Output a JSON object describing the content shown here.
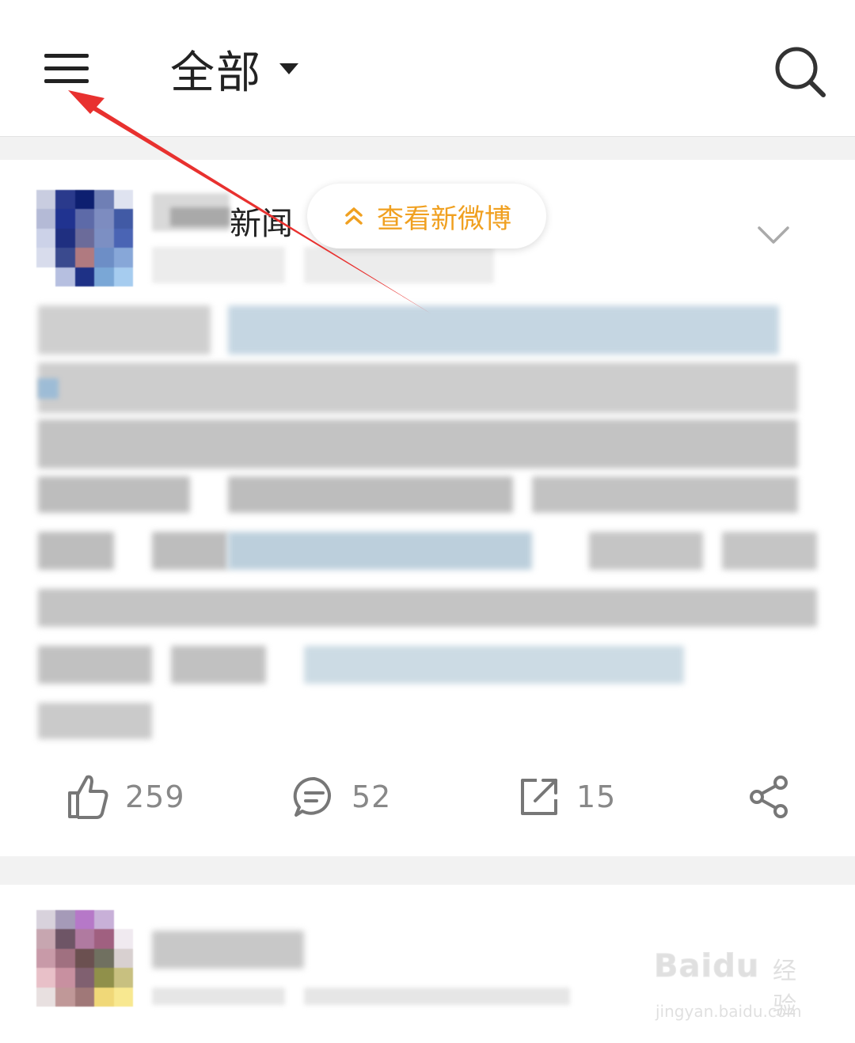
{
  "header": {
    "title": "全部",
    "menu_icon": "hamburger-icon",
    "search_icon": "search-icon"
  },
  "post1": {
    "author_suffix": "新闻",
    "new_weibo_label": "查看新微博",
    "actions": {
      "like_count": "259",
      "comment_count": "52",
      "repost_count": "15"
    }
  },
  "watermark": {
    "brand": "Baidu",
    "brand_sub": "经验",
    "url": "jingyan.baidu.com"
  },
  "colors": {
    "accent": "#f0a020",
    "annotation_arrow": "#e8312f",
    "count_text": "#888888"
  }
}
